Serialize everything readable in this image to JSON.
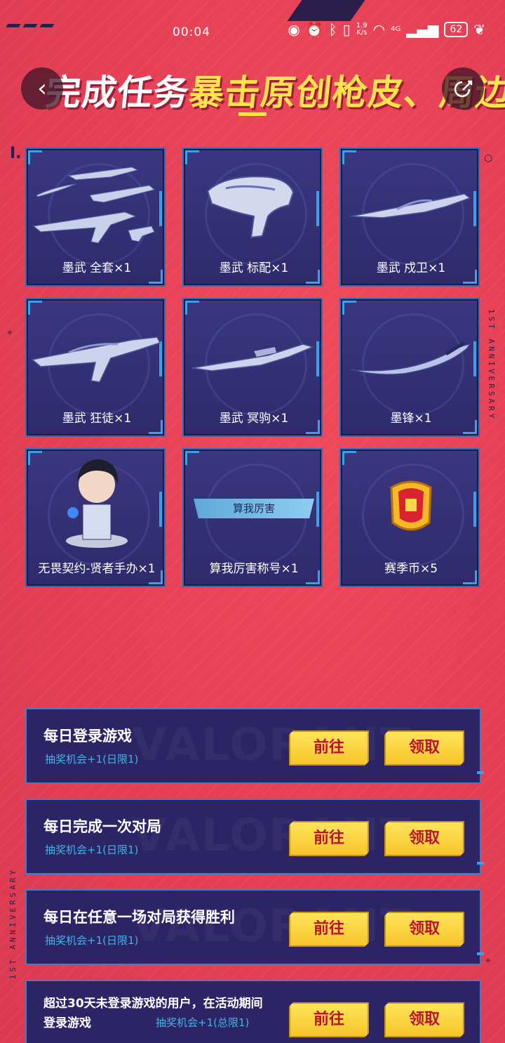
{
  "status_bar": {
    "time": "00:04",
    "net_speed_value": "1.9",
    "net_speed_unit": "K/s",
    "network": "4G",
    "battery": "62"
  },
  "header": {
    "title_white": "完成任务",
    "title_yellow": "暴击原创枪皮、周边",
    "back_icon": "chevron-left-icon",
    "share_icon": "share-icon"
  },
  "decorations": {
    "anniversary_text": "1ST ANNIVERSARY",
    "watermark": "VALORANT"
  },
  "rewards": [
    {
      "label": "墨武 全套×1",
      "icon": "weapon-set-icon"
    },
    {
      "label": "墨武 标配×1",
      "icon": "pistol-icon"
    },
    {
      "label": "墨武 戍卫×1",
      "icon": "rifle-icon"
    },
    {
      "label": "墨武 狂徒×1",
      "icon": "rifle-icon"
    },
    {
      "label": "墨武 冥驹×1",
      "icon": "sniper-icon"
    },
    {
      "label": "墨锋×1",
      "icon": "blade-icon"
    },
    {
      "label": "无畏契约-贤者手办×1",
      "icon": "figure-icon"
    },
    {
      "label": "算我厉害称号×1",
      "icon": "title-badge-icon",
      "badge_text": "算我厉害"
    },
    {
      "label": "赛季币×5",
      "icon": "coin-icon"
    }
  ],
  "tasks": [
    {
      "title": "每日登录游戏",
      "reward": "抽奖机会+1(日限1)",
      "go_label": "前往",
      "claim_label": "领取"
    },
    {
      "title": "每日完成一次对局",
      "reward": "抽奖机会+1(日限1)",
      "go_label": "前往",
      "claim_label": "领取"
    },
    {
      "title": "每日在任意一场对局获得胜利",
      "reward": "抽奖机会+1(日限1)",
      "go_label": "前往",
      "claim_label": "领取"
    },
    {
      "title": "超过30天未登录游戏的用户，在活动期间登录游戏",
      "reward": "抽奖机会+1(总限1)",
      "go_label": "前往",
      "claim_label": "领取"
    }
  ],
  "colors": {
    "background": "#e8445a",
    "card": "#2e2a6b",
    "accent_blue": "#3aa0e8",
    "button_yellow": "#ffe45a",
    "button_text": "#b8132e",
    "title_yellow": "#ffe24d"
  }
}
